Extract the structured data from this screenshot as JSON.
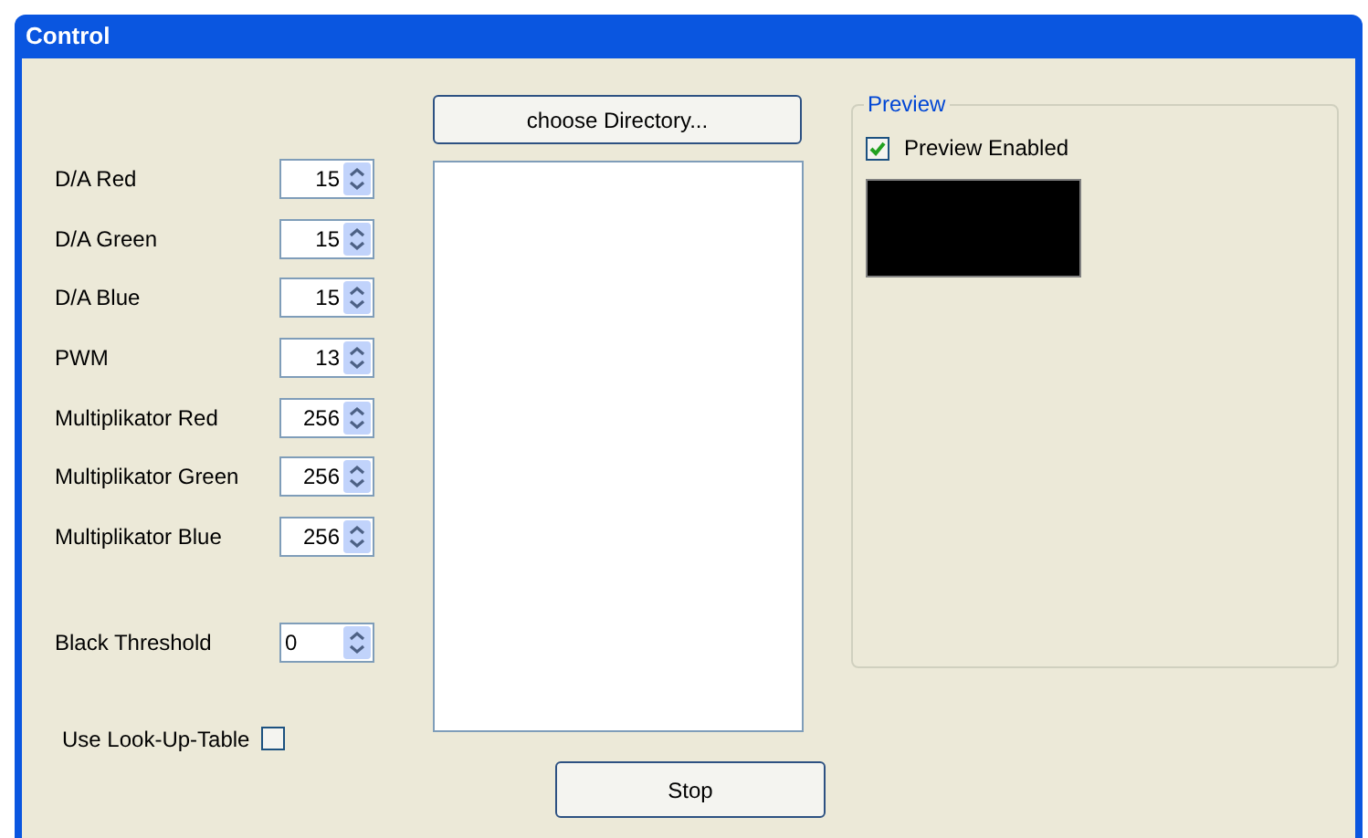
{
  "window": {
    "title": "Control"
  },
  "fields": [
    {
      "label": "D/A Red",
      "value": "15",
      "left_aligned": false
    },
    {
      "label": "D/A Green",
      "value": "15",
      "left_aligned": false
    },
    {
      "label": "D/A Blue",
      "value": "15",
      "left_aligned": false
    },
    {
      "label": "PWM",
      "value": "13",
      "left_aligned": false
    },
    {
      "label": "Multiplikator Red",
      "value": "256",
      "left_aligned": false
    },
    {
      "label": "Multiplikator Green",
      "value": "256",
      "left_aligned": false
    },
    {
      "label": "Multiplikator Blue",
      "value": "256",
      "left_aligned": false
    }
  ],
  "threshold": {
    "label": "Black Threshold",
    "value": "0",
    "left_aligned": true
  },
  "lut": {
    "label": "Use Look-Up-Table",
    "checked": false
  },
  "choose_button": "choose Directory...",
  "stop_button": "Stop",
  "preview": {
    "title": "Preview",
    "checkbox": {
      "label": "Preview Enabled",
      "checked": true
    }
  }
}
